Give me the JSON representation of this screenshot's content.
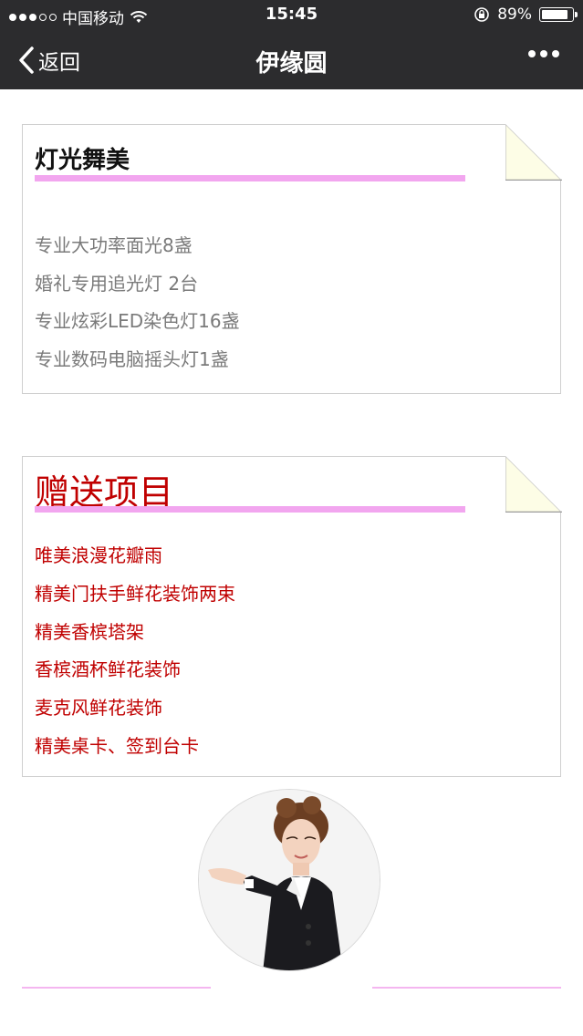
{
  "status_bar": {
    "carrier": "中国移动",
    "time": "15:45",
    "battery": "89%",
    "battery_level": 0.89,
    "icons": [
      "signal-dots",
      "wifi-icon",
      "rotation-lock-icon",
      "battery-icon"
    ]
  },
  "nav": {
    "back_label": "返回",
    "title": "伊缘圆",
    "icons": [
      "chevron-left-icon",
      "more-dots-icon"
    ]
  },
  "lighting": {
    "title": "灯光舞美",
    "items": [
      "专业大功率面光8盏",
      "婚礼专用追光灯 2台",
      "专业炫彩LED染色灯16盏",
      "专业数码电脑摇头灯1盏"
    ]
  },
  "gifts": {
    "title": "赠送项目",
    "items": [
      "唯美浪漫花瓣雨",
      "精美门扶手鲜花装饰两束",
      "精美香槟塔架",
      "香槟酒杯鲜花装饰",
      "麦克风鲜花装饰",
      "精美桌卡、签到台卡"
    ]
  },
  "colors": {
    "bar_background": "#2c2c2e",
    "underline": "#f2a6ef",
    "gift_text": "#c00000",
    "fold_fill": "#fdfde6"
  }
}
